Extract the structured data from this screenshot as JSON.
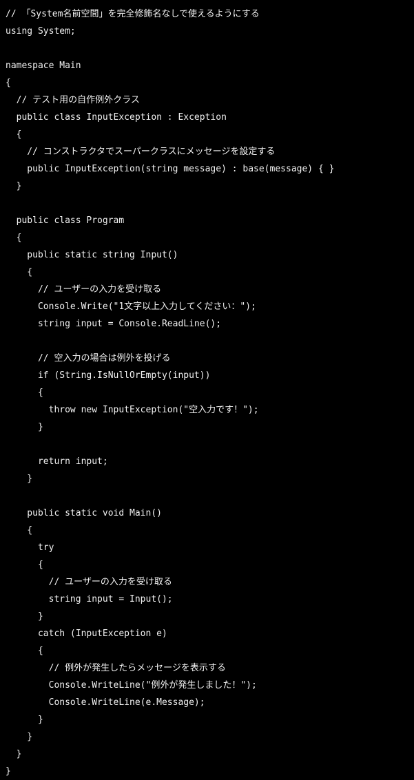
{
  "editor": {
    "language": "csharp",
    "background_color": "#000000",
    "text_color": "#f2f2f2",
    "font_size_px": 13,
    "line_height_px": 25
  },
  "code": {
    "lines": [
      "// 「System名前空間」を完全修飾名なしで使えるようにする",
      "using System;",
      "",
      "namespace Main",
      "{",
      "  // テスト用の自作例外クラス",
      "  public class InputException : Exception",
      "  {",
      "    // コンストラクタでスーパークラスにメッセージを設定する",
      "    public InputException(string message) : base(message) { }",
      "  }",
      "",
      "  public class Program",
      "  {",
      "    public static string Input()",
      "    {",
      "      // ユーザーの入力を受け取る",
      "      Console.Write(\"1文字以上入力してください：\");",
      "      string input = Console.ReadLine();",
      "",
      "      // 空入力の場合は例外を投げる",
      "      if (String.IsNullOrEmpty(input))",
      "      {",
      "        throw new InputException(\"空入力です！\");",
      "      }",
      "",
      "      return input;",
      "    }",
      "",
      "    public static void Main()",
      "    {",
      "      try",
      "      {",
      "        // ユーザーの入力を受け取る",
      "        string input = Input();",
      "      }",
      "      catch (InputException e)",
      "      {",
      "        // 例外が発生したらメッセージを表示する",
      "        Console.WriteLine(\"例外が発生しました！\");",
      "        Console.WriteLine(e.Message);",
      "      }",
      "    }",
      "  }",
      "}"
    ]
  }
}
